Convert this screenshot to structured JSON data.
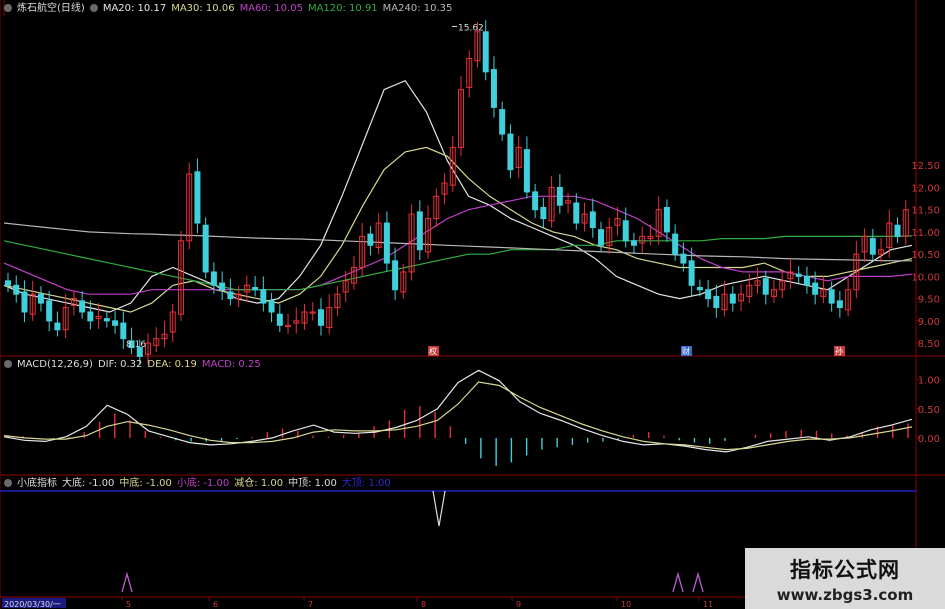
{
  "main_header": {
    "stock_name": "炼石航空(日线)",
    "ma20": "MA20: 10.17",
    "ma30": "MA30: 10.06",
    "ma60": "MA60: 10.05",
    "ma120": "MA120: 10.91",
    "ma240": "MA240: 10.35"
  },
  "macd_header": {
    "name": "MACD(12,26,9)",
    "dif": "DIF: 0.32",
    "dea": "DEA: 0.19",
    "macd": "MACD: 0.25"
  },
  "ind_header": {
    "name": "小底指标",
    "d1": "大底: -1.00",
    "d2": "中底: -1.00",
    "d3": "小底: -1.00",
    "d4": "减仓: 1.00",
    "d5": "中顶: 1.00",
    "d6": "大顶: 1.00"
  },
  "colors": {
    "up": "#e8303a",
    "down": "#3fd0dc",
    "ma20": "#e6e6e6",
    "ma30": "#d8d890",
    "ma60": "#c040c8",
    "ma120": "#30b040",
    "ma240": "#b8b8b8",
    "axis_red": "#8b0000",
    "label_red": "#c83a3a",
    "blue_line": "#2020c0",
    "signal": "#c060d0"
  },
  "x_labels": {
    "start": "2020/03/30/一",
    "months": [
      "5",
      "6",
      "7",
      "8",
      "9",
      "10",
      "11"
    ]
  },
  "markers": {
    "high_label": "15.62",
    "low_label": "8.16",
    "marks": [
      "权",
      "财",
      "孙"
    ]
  },
  "watermark": {
    "line1": "指标公式网",
    "line2": "www.zbgs3.com"
  },
  "chart_data": [
    {
      "type": "candlestick",
      "title": "炼石航空(日线)",
      "y_ticks": [
        8.5,
        9.0,
        9.5,
        10.0,
        10.5,
        11.0,
        11.5,
        12.0,
        12.5
      ],
      "ylim": [
        8.3,
        15.9
      ],
      "high": 15.62,
      "low": 8.16,
      "close_path": [
        9.8,
        9.6,
        9.2,
        9.6,
        9.4,
        9.0,
        8.8,
        9.3,
        9.5,
        9.2,
        9.0,
        9.1,
        9.0,
        8.9,
        8.6,
        8.4,
        8.2,
        8.5,
        8.6,
        8.7,
        9.2,
        10.8,
        12.3,
        11.2,
        10.1,
        9.8,
        9.7,
        9.5,
        9.6,
        9.8,
        9.7,
        9.4,
        9.2,
        8.9,
        8.9,
        9.0,
        9.2,
        9.2,
        8.9,
        9.3,
        9.6,
        9.9,
        10.2,
        10.9,
        10.7,
        11.2,
        10.3,
        9.7,
        10.1,
        11.4,
        10.6,
        11.3,
        11.8,
        12.1,
        12.9,
        14.2,
        14.9,
        15.5,
        14.6,
        13.8,
        13.2,
        12.4,
        12.9,
        11.9,
        11.5,
        11.3,
        12.0,
        11.6,
        11.7,
        11.2,
        11.4,
        11.1,
        10.7,
        11.1,
        11.3,
        10.8,
        10.7,
        10.9,
        10.9,
        11.5,
        11.0,
        10.5,
        10.3,
        9.8,
        9.7,
        9.5,
        9.3,
        9.6,
        9.4,
        9.6,
        9.8,
        9.9,
        9.6,
        9.7,
        9.9,
        10.1,
        10.0,
        9.8,
        9.6,
        9.7,
        9.4,
        9.3,
        9.7,
        10.5,
        10.9,
        10.5,
        10.6,
        11.2,
        10.9,
        11.5
      ],
      "series": [
        {
          "name": "MA20",
          "values": [
            9.8,
            9.6,
            9.5,
            9.4,
            9.3,
            9.2,
            9.4,
            10.0,
            10.2,
            10.0,
            9.8,
            9.5,
            9.4,
            9.5,
            10.0,
            10.7,
            11.8,
            13.0,
            14.2,
            14.4,
            13.7,
            12.6,
            11.8,
            11.6,
            11.3,
            11.1,
            10.9,
            10.7,
            10.4,
            10.0,
            9.8,
            9.6,
            9.5,
            9.6,
            9.8,
            9.9,
            10.0,
            9.9,
            9.8,
            9.7,
            10.0,
            10.3,
            10.6,
            10.7
          ]
        },
        {
          "name": "MA30",
          "values": [
            9.8,
            9.7,
            9.6,
            9.5,
            9.4,
            9.3,
            9.2,
            9.4,
            9.8,
            9.9,
            9.7,
            9.6,
            9.5,
            9.4,
            9.6,
            10.0,
            10.7,
            11.6,
            12.4,
            12.8,
            12.9,
            12.7,
            12.2,
            11.8,
            11.5,
            11.2,
            11.0,
            10.9,
            10.7,
            10.6,
            10.4,
            10.3,
            10.2,
            10.2,
            10.2,
            10.2,
            10.3,
            10.1,
            10.0,
            10.0,
            10.1,
            10.2,
            10.3,
            10.4
          ]
        },
        {
          "name": "MA60",
          "values": [
            10.3,
            10.1,
            9.9,
            9.7,
            9.6,
            9.6,
            9.6,
            9.7,
            9.7,
            9.7,
            9.7,
            9.7,
            9.7,
            9.7,
            9.7,
            9.8,
            10.0,
            10.2,
            10.4,
            10.7,
            11.0,
            11.3,
            11.5,
            11.6,
            11.7,
            11.8,
            11.8,
            11.8,
            11.7,
            11.5,
            11.3,
            11.0,
            10.7,
            10.4,
            10.2,
            10.1,
            10.1,
            10.1,
            10.0,
            9.9,
            10.0,
            10.0,
            10.0,
            10.05
          ]
        },
        {
          "name": "MA120",
          "values": [
            10.8,
            10.7,
            10.6,
            10.5,
            10.4,
            10.3,
            10.2,
            10.1,
            10.0,
            9.9,
            9.8,
            9.7,
            9.7,
            9.7,
            9.7,
            9.8,
            9.9,
            10.0,
            10.1,
            10.2,
            10.3,
            10.4,
            10.5,
            10.5,
            10.6,
            10.6,
            10.6,
            10.7,
            10.7,
            10.8,
            10.8,
            10.8,
            10.8,
            10.8,
            10.85,
            10.85,
            10.85,
            10.9,
            10.9,
            10.9,
            10.9,
            10.9,
            10.9,
            10.91
          ]
        },
        {
          "name": "MA240",
          "values": [
            11.2,
            11.15,
            11.1,
            11.05,
            11.0,
            10.98,
            10.96,
            10.95,
            10.93,
            10.92,
            10.9,
            10.88,
            10.86,
            10.85,
            10.84,
            10.82,
            10.8,
            10.78,
            10.76,
            10.74,
            10.72,
            10.7,
            10.68,
            10.66,
            10.64,
            10.62,
            10.6,
            10.58,
            10.56,
            10.54,
            10.52,
            10.5,
            10.48,
            10.46,
            10.45,
            10.44,
            10.42,
            10.4,
            10.39,
            10.38,
            10.37,
            10.36,
            10.35,
            10.35
          ]
        }
      ]
    },
    {
      "type": "bar",
      "title": "MACD(12,26,9)",
      "y_ticks": [
        0.0,
        0.5,
        1.0
      ],
      "ylim": [
        -0.55,
        1.2
      ],
      "series": [
        {
          "name": "MACD",
          "values": [
            0.05,
            0.03,
            0.0,
            -0.02,
            0.02,
            0.1,
            0.28,
            0.42,
            0.3,
            0.12,
            0.02,
            -0.04,
            -0.06,
            -0.06,
            -0.05,
            -0.02,
            0.02,
            0.1,
            0.16,
            0.12,
            0.04,
            0.02,
            0.05,
            0.08,
            0.2,
            0.3,
            0.48,
            0.55,
            0.45,
            0.2,
            -0.1,
            -0.35,
            -0.48,
            -0.42,
            -0.3,
            -0.2,
            -0.16,
            -0.12,
            -0.08,
            -0.06,
            -0.03,
            0.05,
            0.1,
            0.04,
            -0.04,
            -0.08,
            -0.1,
            -0.05,
            0.0,
            0.05,
            0.08,
            0.12,
            0.14,
            0.12,
            0.08,
            0.04,
            0.1,
            0.2,
            0.22,
            0.25
          ]
        },
        {
          "name": "DIF",
          "values": [
            0.02,
            -0.04,
            -0.06,
            0.02,
            0.2,
            0.56,
            0.4,
            0.12,
            0.02,
            -0.08,
            -0.12,
            -0.1,
            -0.06,
            0.0,
            0.12,
            0.22,
            0.1,
            0.08,
            0.1,
            0.18,
            0.3,
            0.5,
            0.95,
            1.16,
            0.98,
            0.62,
            0.42,
            0.3,
            0.16,
            0.04,
            -0.06,
            -0.12,
            -0.1,
            -0.14,
            -0.2,
            -0.24,
            -0.16,
            -0.06,
            -0.02,
            0.02,
            -0.04,
            0.02,
            0.14,
            0.22,
            0.32
          ]
        },
        {
          "name": "DEA",
          "values": [
            0.04,
            0.0,
            -0.02,
            -0.02,
            0.04,
            0.2,
            0.28,
            0.22,
            0.14,
            0.04,
            -0.04,
            -0.08,
            -0.08,
            -0.06,
            0.0,
            0.1,
            0.14,
            0.12,
            0.12,
            0.14,
            0.2,
            0.3,
            0.58,
            0.96,
            0.9,
            0.7,
            0.52,
            0.38,
            0.24,
            0.12,
            0.02,
            -0.06,
            -0.1,
            -0.12,
            -0.16,
            -0.2,
            -0.18,
            -0.12,
            -0.06,
            -0.02,
            -0.02,
            0.0,
            0.06,
            0.12,
            0.19
          ]
        }
      ]
    },
    {
      "type": "line",
      "title": "小底指标",
      "series": [
        {
          "name": "大底",
          "value": -1.0
        },
        {
          "name": "中底",
          "value": -1.0
        },
        {
          "name": "小底",
          "value": -1.0
        },
        {
          "name": "减仓",
          "value": 1.0
        },
        {
          "name": "中顶",
          "value": 1.0
        },
        {
          "name": "大顶",
          "value": 1.0
        }
      ]
    }
  ]
}
